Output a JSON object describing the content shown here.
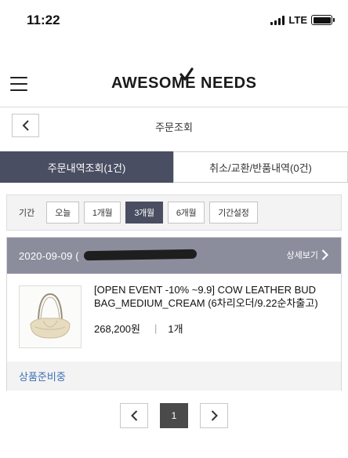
{
  "status_bar": {
    "time": "11:22",
    "network": "LTE"
  },
  "header": {
    "logo": "AWESOME NEEDS"
  },
  "subnav": {
    "title": "주문조회"
  },
  "tabs": [
    {
      "label": "주문내역조회(1건)",
      "active": true
    },
    {
      "label": "취소/교환/반품내역(0건)",
      "active": false
    }
  ],
  "period": {
    "label": "기간",
    "options": [
      {
        "label": "오늘",
        "active": false
      },
      {
        "label": "1개월",
        "active": false
      },
      {
        "label": "3개월",
        "active": true
      },
      {
        "label": "6개월",
        "active": false
      },
      {
        "label": "기간설정",
        "active": false
      }
    ]
  },
  "order": {
    "date": "2020-09-09 (",
    "detail_label": "상세보기",
    "product_name": "[OPEN EVENT -10% ~9.9] COW LEATHER BUD BAG_MEDIUM_CREAM (6차리오더/9.22순차출고)",
    "price": "268,200원",
    "quantity": "1개",
    "status": "상품준비중"
  },
  "pagination": {
    "current": "1"
  },
  "colors": {
    "accent": "#4a4e62",
    "header_bar": "#8b8d9c",
    "status_text": "#3a6fb5"
  },
  "icons": [
    "chevron-left-icon",
    "chevron-right-icon",
    "hamburger-menu-icon",
    "checkmark-icon",
    "signal-icon",
    "battery-icon"
  ]
}
